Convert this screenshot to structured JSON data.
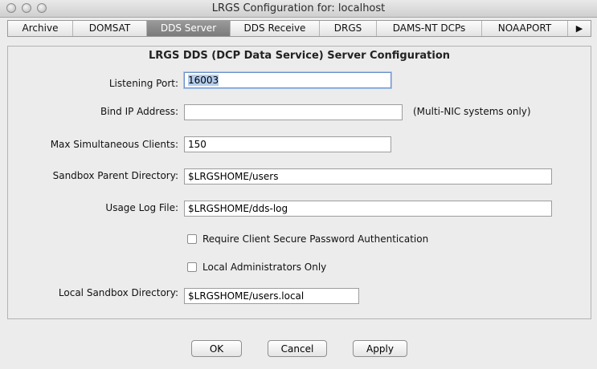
{
  "window": {
    "title": "LRGS Configuration for:  localhost"
  },
  "tabs": [
    {
      "label": "Archive"
    },
    {
      "label": "DOMSAT"
    },
    {
      "label": "DDS Server",
      "active": true
    },
    {
      "label": "DDS Receive"
    },
    {
      "label": "DRGS"
    },
    {
      "label": "DAMS-NT DCPs"
    },
    {
      "label": "NOAAPORT"
    },
    {
      "label": "▶"
    }
  ],
  "panel": {
    "title": "LRGS DDS (DCP Data Service) Server Configuration",
    "listening_port": {
      "label": "Listening Port:",
      "value": "16003"
    },
    "bind_ip": {
      "label": "Bind IP Address:",
      "value": "",
      "hint": "(Multi-NIC systems only)"
    },
    "max_clients": {
      "label": "Max Simultaneous Clients:",
      "value": "150"
    },
    "sandbox_parent": {
      "label": "Sandbox Parent Directory:",
      "value": "$LRGSHOME/users"
    },
    "usage_log": {
      "label": "Usage Log File:",
      "value": "$LRGSHOME/dds-log"
    },
    "require_secure_auth": {
      "label": "Require Client Secure Password Authentication",
      "checked": false
    },
    "local_admins_only": {
      "label": "Local Administrators Only",
      "checked": false
    },
    "local_sandbox": {
      "label": "Local Sandbox Directory:",
      "value": "$LRGSHOME/users.local"
    }
  },
  "buttons": {
    "ok": "OK",
    "cancel": "Cancel",
    "apply": "Apply"
  }
}
